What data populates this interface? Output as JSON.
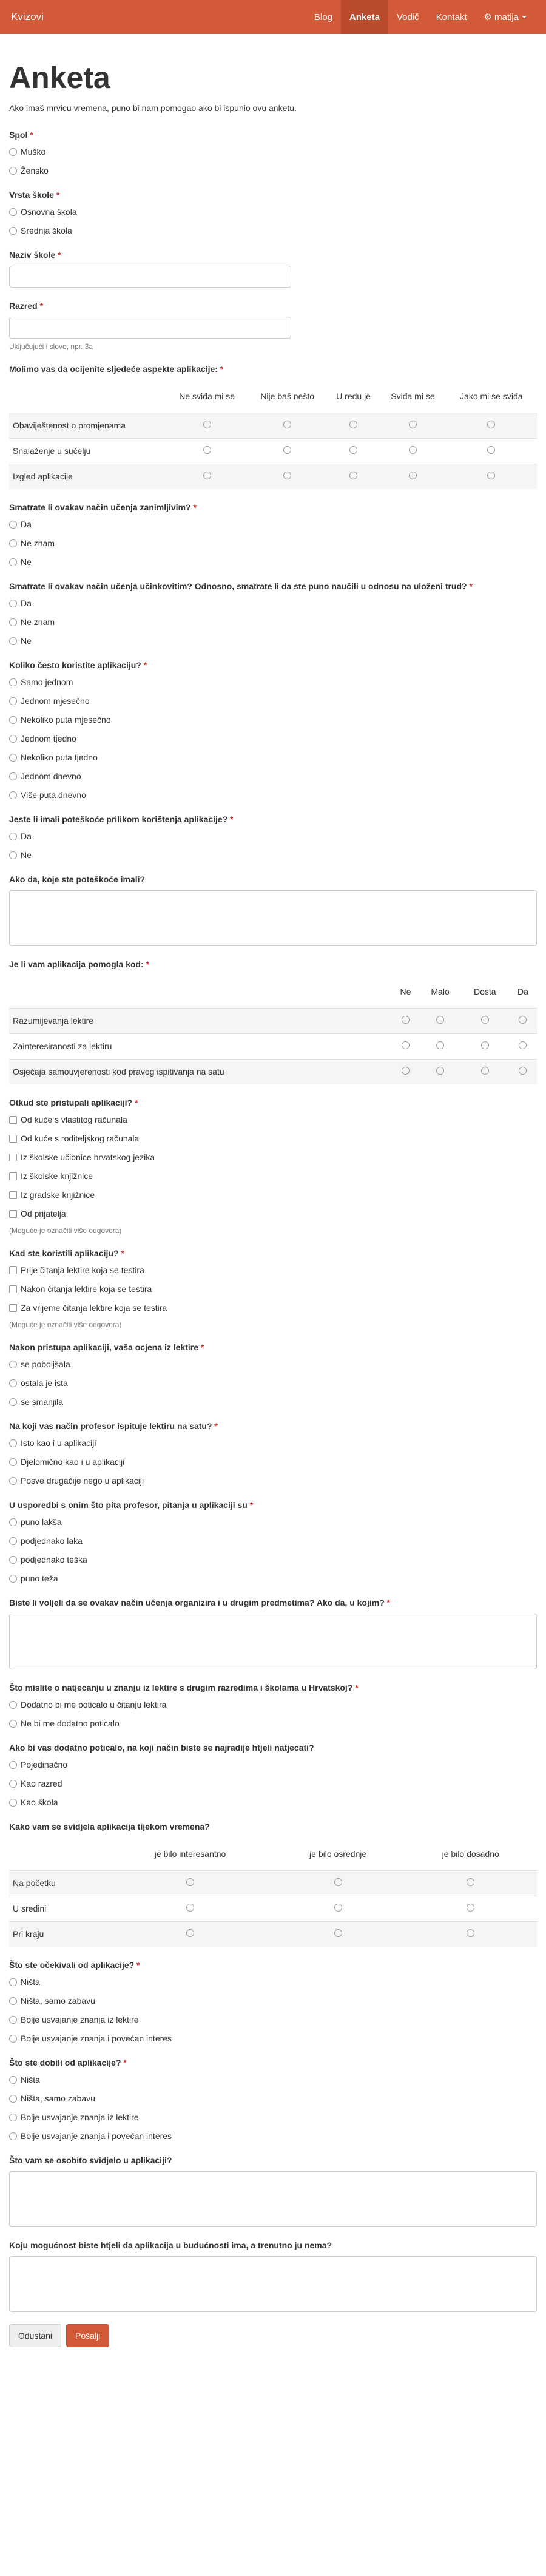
{
  "nav": {
    "brand": "Kvizovi",
    "links": [
      "Blog",
      "Anketa",
      "Vodič",
      "Kontakt"
    ],
    "user": "matija"
  },
  "page": {
    "title": "Anketa",
    "intro": "Ako imaš mrvicu vremena, puno bi nam pomogao ako bi ispunio ovu anketu."
  },
  "q_spol": {
    "label": "Spol",
    "options": [
      "Muško",
      "Žensko"
    ]
  },
  "q_skola": {
    "label": "Vrsta škole",
    "options": [
      "Osnovna škola",
      "Srednja škola"
    ]
  },
  "q_naziv": {
    "label": "Naziv škole"
  },
  "q_razred": {
    "label": "Razred",
    "help": "Uključujući i slovo, npr. 3a"
  },
  "q_aspekti": {
    "label": "Molimo vas da ocijenite sljedeće aspekte aplikacije:",
    "columns": [
      "Ne sviđa mi se",
      "Nije baš nešto",
      "U redu je",
      "Sviđa mi se",
      "Jako mi se sviđa"
    ],
    "rows": [
      "Obaviještenost o promjenama",
      "Snalaženje u sučelju",
      "Izgled aplikacije"
    ]
  },
  "q_zanimljiv": {
    "label": "Smatrate li ovakav način učenja zanimljivim?",
    "options": [
      "Da",
      "Ne znam",
      "Ne"
    ]
  },
  "q_ucinkovit": {
    "label": "Smatrate li ovakav način učenja učinkovitim? Odnosno, smatrate li da ste puno naučili u odnosu na uloženi trud?",
    "options": [
      "Da",
      "Ne znam",
      "Ne"
    ]
  },
  "q_cesto": {
    "label": "Koliko često koristite aplikaciju?",
    "options": [
      "Samo jednom",
      "Jednom mjesečno",
      "Nekoliko puta mjesečno",
      "Jednom tjedno",
      "Nekoliko puta tjedno",
      "Jednom dnevno",
      "Više puta dnevno"
    ]
  },
  "q_poteskoce": {
    "label": "Jeste li imali poteškoće prilikom korištenja aplikacije?",
    "options": [
      "Da",
      "Ne"
    ]
  },
  "q_kojepot": {
    "label": "Ako da, koje ste poteškoće imali?"
  },
  "q_pomogla": {
    "label": "Je li vam aplikacija pomogla kod:",
    "columns": [
      "Ne",
      "Malo",
      "Dosta",
      "Da"
    ],
    "rows": [
      "Razumijevanja lektire",
      "Zainteresiranosti za lektiru",
      "Osjećaja samouvjerenosti kod pravog ispitivanja na satu"
    ]
  },
  "q_pristup": {
    "label": "Otkud ste pristupali aplikaciji?",
    "options": [
      "Od kuće s vlastitog računala",
      "Od kuće s roditeljskog računala",
      "Iz školske učionice hrvatskog jezika",
      "Iz školske knjižnice",
      "Iz gradske knjižnice",
      "Od prijatelja"
    ],
    "help": "(Moguće je označiti više odgovora)"
  },
  "q_kada": {
    "label": "Kad ste koristili aplikaciju?",
    "options": [
      "Prije čitanja lektire koja se testira",
      "Nakon čitanja lektire koja se testira",
      "Za vrijeme čitanja lektire koja se testira"
    ],
    "help": "(Moguće je označiti više odgovora)"
  },
  "q_ocjena": {
    "label": "Nakon pristupa aplikaciji, vaša ocjena iz lektire",
    "options": [
      "se poboljšala",
      "ostala je ista",
      "se smanjila"
    ]
  },
  "q_profesor": {
    "label": "Na koji vas način profesor ispituje lektiru na satu?",
    "options": [
      "Isto kao i u aplikaciji",
      "Djelomično kao i u aplikaciji",
      "Posve drugačije nego u aplikaciji"
    ]
  },
  "q_pitanja": {
    "label": "U usporedbi s onim što pita profesor, pitanja u aplikaciji su",
    "options": [
      "puno lakša",
      "podjednako laka",
      "podjednako teška",
      "puno teža"
    ]
  },
  "q_predmeti": {
    "label": "Biste li voljeli da se ovakav način učenja organizira i u drugim predmetima? Ako da, u kojim?"
  },
  "q_natjecanje": {
    "label": "Što mislite o natjecanju u znanju iz lektire s drugim razredima i školama u Hrvatskoj?",
    "options": [
      "Dodatno bi me poticalo u čitanju lektira",
      "Ne bi me dodatno poticalo"
    ]
  },
  "q_nacin": {
    "label": "Ako bi vas dodatno poticalo, na koji način biste se najradije htjeli natjecati?",
    "options": [
      "Pojedinačno",
      "Kao razred",
      "Kao škola"
    ]
  },
  "q_svidjela": {
    "label": "Kako vam se svidjela aplikacija tijekom vremena?",
    "columns": [
      "je bilo interesantno",
      "je bilo osrednje",
      "je bilo dosadno"
    ],
    "rows": [
      "Na početku",
      "U sredini",
      "Pri kraju"
    ]
  },
  "q_ocekivali": {
    "label": "Što ste očekivali od aplikacije?",
    "options": [
      "Ništa",
      "Ništa, samo zabavu",
      "Bolje usvajanje znanja iz lektire",
      "Bolje usvajanje znanja i povećan interes"
    ]
  },
  "q_dobili": {
    "label": "Što ste dobili od aplikacije?",
    "options": [
      "Ništa",
      "Ništa, samo zabavu",
      "Bolje usvajanje znanja iz lektire",
      "Bolje usvajanje znanja i povećan interes"
    ]
  },
  "q_svidjelo": {
    "label": "Što vam se osobito svidjelo u aplikaciji?"
  },
  "q_mogucnost": {
    "label": "Koju mogućnost biste htjeli da aplikacija u budućnosti ima, a trenutno ju nema?"
  },
  "buttons": {
    "cancel": "Odustani",
    "submit": "Pošalji"
  }
}
